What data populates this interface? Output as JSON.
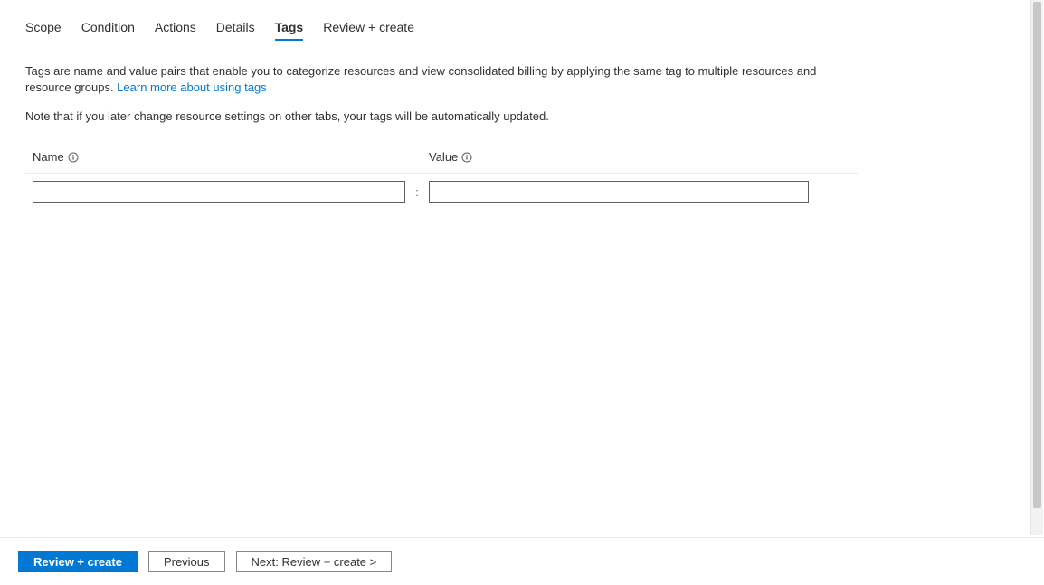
{
  "tabs": {
    "items": [
      {
        "label": "Scope",
        "active": false
      },
      {
        "label": "Condition",
        "active": false
      },
      {
        "label": "Actions",
        "active": false
      },
      {
        "label": "Details",
        "active": false
      },
      {
        "label": "Tags",
        "active": true
      },
      {
        "label": "Review + create",
        "active": false
      }
    ]
  },
  "description": {
    "text_before_link": "Tags are name and value pairs that enable you to categorize resources and view consolidated billing by applying the same tag to multiple resources and resource groups. ",
    "link_label": "Learn more about using tags"
  },
  "note": "Note that if you later change resource settings on other tabs, your tags will be automatically updated.",
  "tags_table": {
    "headers": {
      "name": "Name",
      "value": "Value"
    },
    "separator": ":",
    "row": {
      "name_value": "",
      "value_value": ""
    }
  },
  "footer": {
    "review_create_label": "Review + create",
    "previous_label": "Previous",
    "next_label": "Next: Review + create >"
  }
}
